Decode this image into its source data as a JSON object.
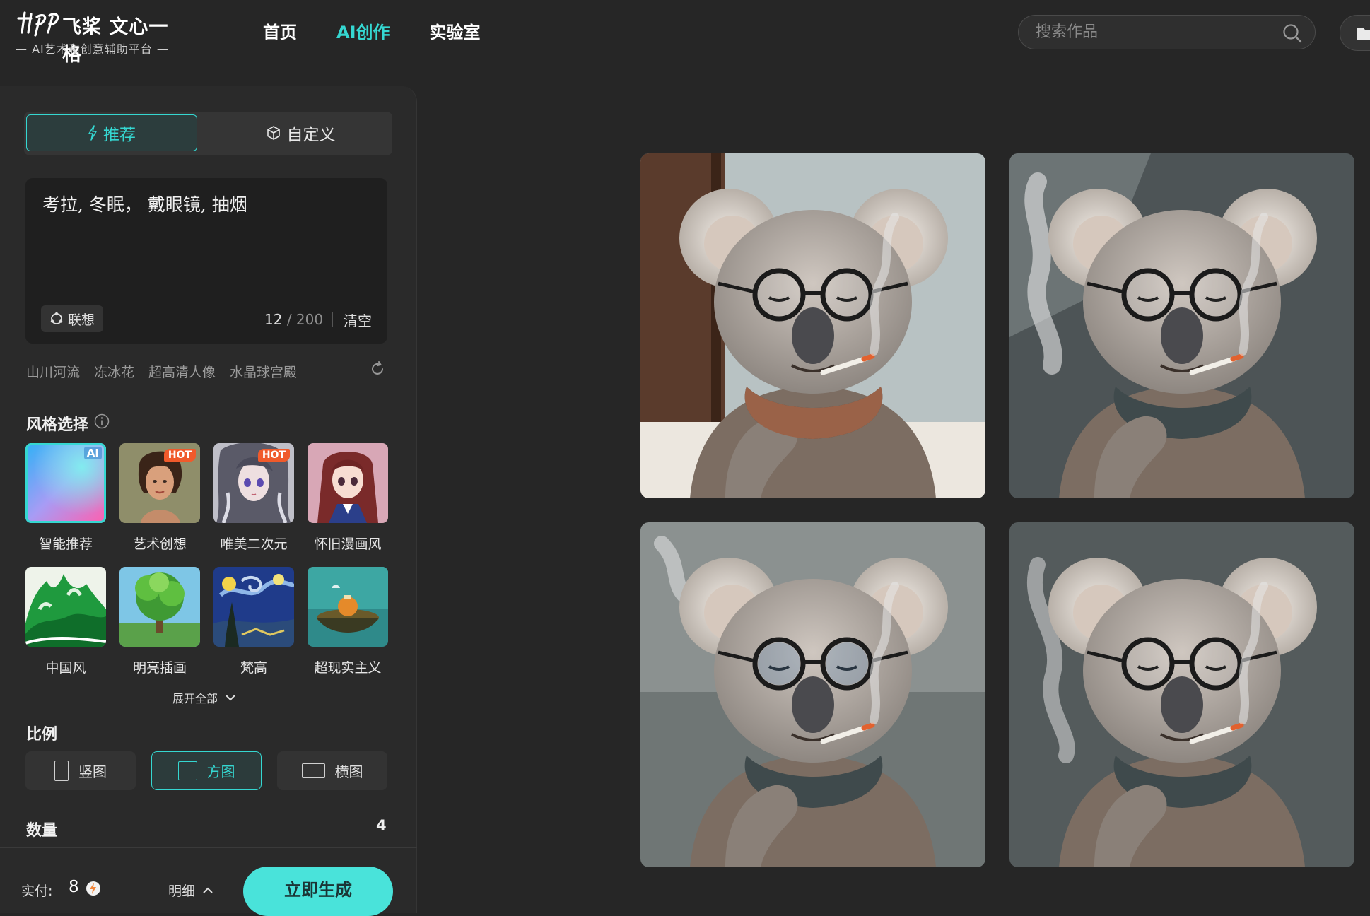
{
  "header": {
    "logo_name": "飞桨 文心一格",
    "logo_sub": "— AI艺术和创意辅助平台 —",
    "nav": [
      {
        "label": "首页",
        "active": false
      },
      {
        "label": "AI创作",
        "active": true
      },
      {
        "label": "实验室",
        "active": false
      }
    ],
    "search": {
      "placeholder": "搜索作品",
      "value": ""
    }
  },
  "panel": {
    "mode_tabs": {
      "recommend": "推荐",
      "custom": "自定义"
    },
    "prompt": {
      "value": "考拉, 冬眠， 戴眼镜, 抽烟",
      "associate_label": "联想",
      "count": "12",
      "max": "200",
      "clear_label": "清空"
    },
    "suggestions": [
      "山川河流",
      "冻冰花",
      "超高清人像",
      "水晶球宫殿"
    ],
    "style_section": {
      "title": "风格选择",
      "styles": [
        {
          "label": "智能推荐",
          "badge": "AI",
          "selected": true
        },
        {
          "label": "艺术创想",
          "badge": "HOT",
          "selected": false
        },
        {
          "label": "唯美二次元",
          "badge": "HOT",
          "selected": false
        },
        {
          "label": "怀旧漫画风",
          "badge": "",
          "selected": false
        },
        {
          "label": "中国风",
          "badge": "",
          "selected": false
        },
        {
          "label": "明亮插画",
          "badge": "",
          "selected": false
        },
        {
          "label": "梵高",
          "badge": "",
          "selected": false
        },
        {
          "label": "超现实主义",
          "badge": "",
          "selected": false
        }
      ],
      "expand_label": "展开全部"
    },
    "ratio_section": {
      "title": "比例",
      "options": [
        {
          "label": "竖图",
          "selected": false
        },
        {
          "label": "方图",
          "selected": true
        },
        {
          "label": "横图",
          "selected": false
        }
      ]
    },
    "quantity": {
      "title": "数量",
      "value": "4"
    },
    "footer": {
      "pay_label": "实付:",
      "pay_value": "8",
      "detail_label": "明细",
      "generate_label": "立即生成"
    }
  },
  "results": {
    "count": 4,
    "image_subject": "koala-with-glasses-smoking"
  },
  "colors": {
    "accent": "#35d7d1",
    "generate_button": "#49e3da",
    "background": "#262626",
    "panel": "#2a2a2a",
    "hot_badge": "#f05a2b"
  }
}
